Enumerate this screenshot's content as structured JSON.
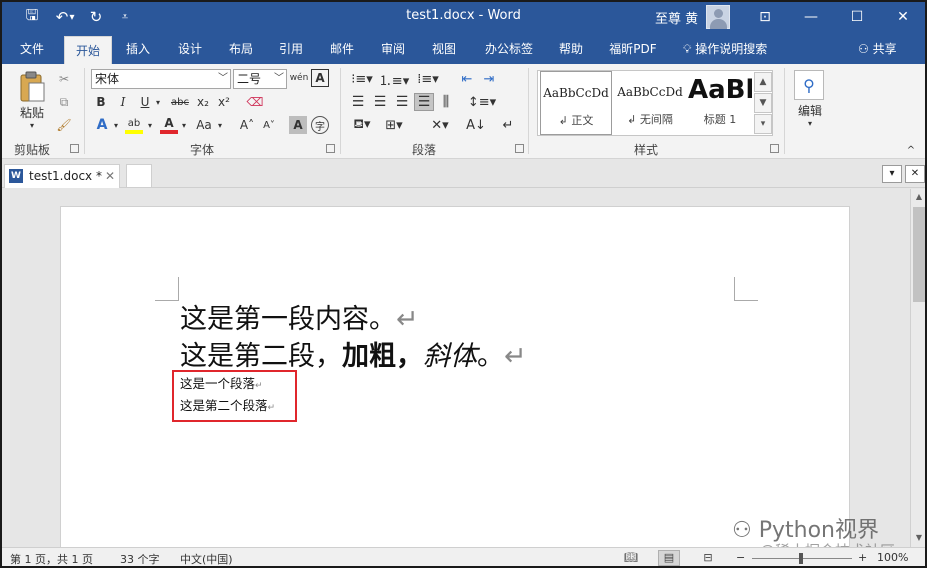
{
  "window": {
    "title": "test1.docx  -  Word",
    "user": "至尊 黄",
    "controls": {
      "ribbon_display": "⊡",
      "minimize": "—",
      "maximize": "☐",
      "close": "✕"
    }
  },
  "quick_access": {
    "save": "🖫",
    "undo": "↶",
    "undo_more": "▾",
    "redo": "↻",
    "customize": "⩡"
  },
  "tabs": [
    "文件",
    "开始",
    "插入",
    "设计",
    "布局",
    "引用",
    "邮件",
    "审阅",
    "视图",
    "办公标签",
    "帮助",
    "福昕PDF"
  ],
  "active_tab": "开始",
  "tell_me": "操作说明搜索",
  "share": "共享",
  "ribbon": {
    "clipboard": {
      "label": "剪贴板",
      "paste": "粘贴"
    },
    "font": {
      "label": "字体",
      "font_name": "宋体",
      "font_size": "二号",
      "phonetic": "wén",
      "bold": "B",
      "italic": "I",
      "underline": "U",
      "strike": "abc",
      "subscript": "x₂",
      "superscript": "x²",
      "text_effects": "A",
      "highlight": "ab",
      "font_color": "A",
      "change_case": "Aa",
      "grow": "A˄",
      "shrink": "A˅",
      "char_shading": "A",
      "enclose": "字"
    },
    "paragraph": {
      "label": "段落"
    },
    "styles": {
      "label": "样式",
      "items": [
        {
          "sample": "AaBbCcDd",
          "name": "↲ 正文"
        },
        {
          "sample": "AaBbCcDd",
          "name": "↲ 无间隔"
        },
        {
          "sample": "AaBl",
          "name": "标题 1"
        }
      ]
    },
    "editing": {
      "label": "编辑"
    }
  },
  "doc_tab": {
    "name": "test1.docx *",
    "close": "✕",
    "word_icon": "W"
  },
  "document": {
    "line1": "这是第一段内容。",
    "line2_plain": "这是第二段，",
    "line2_bold": "加粗，",
    "line2_italic": "斜体",
    "line2_end": "。",
    "small1": "这是一个段落",
    "small2": "这是第二个段落",
    "mark": "↵"
  },
  "status": {
    "page": "第 1 页，共 1 页",
    "words": "33 个字",
    "language": "中文(中国)",
    "zoom": "100%"
  },
  "watermark": {
    "line1": "Python视界",
    "line2": "@稀土掘金技术社区"
  },
  "colors": {
    "accent": "#2b579a",
    "highlight_box": "#e0262c"
  }
}
